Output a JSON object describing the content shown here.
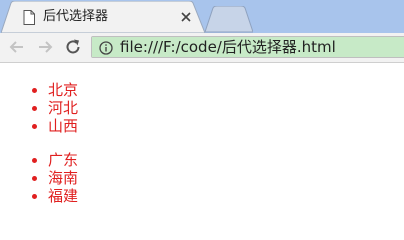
{
  "tab": {
    "title": "后代选择器",
    "icon": "page-icon"
  },
  "toolbar": {
    "back_icon": "back-arrow-icon",
    "forward_icon": "forward-arrow-icon",
    "reload_icon": "reload-icon",
    "url": "file:///F:/code/后代选择器.html"
  },
  "lists": [
    {
      "items": [
        "北京",
        "河北",
        "山西"
      ]
    },
    {
      "items": [
        "广东",
        "海南",
        "福建"
      ]
    }
  ],
  "colors": {
    "text_accent": "#e02020",
    "tab_strip": "#a8c4ec",
    "secure_chip": "#c7eac7"
  }
}
